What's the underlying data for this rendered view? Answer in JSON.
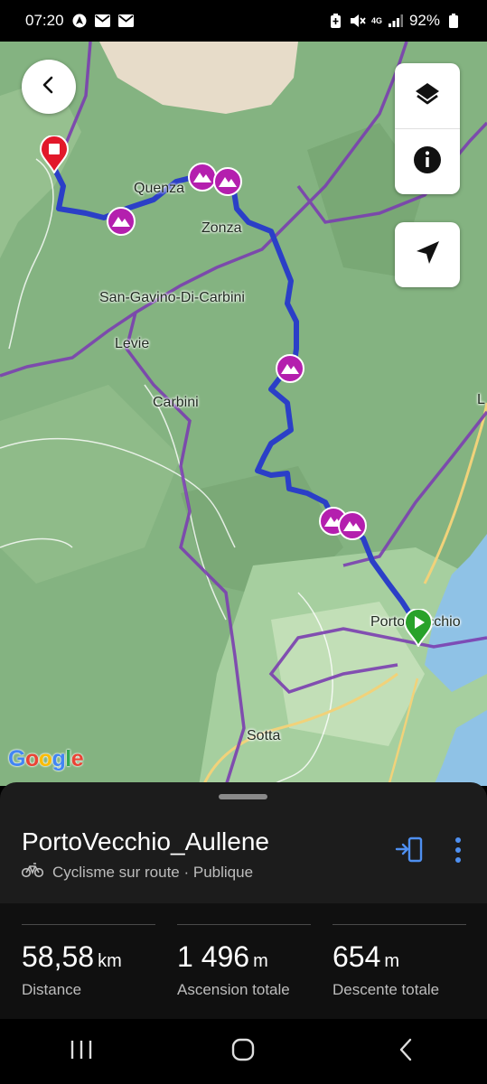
{
  "status_bar": {
    "time": "07:20",
    "network": "4G",
    "battery": "92%"
  },
  "map": {
    "places": [
      "Quenza",
      "Zonza",
      "San-Gavino-Di-Carbini",
      "Levie",
      "Carbini",
      "Porto-Vecchio",
      "Sotta",
      "L"
    ],
    "google_label": "Google",
    "icons": {
      "back": "back-arrow-icon",
      "layers": "layers-icon",
      "info": "info-icon",
      "locate": "navigation-arrow-icon",
      "start": "start-flag-icon",
      "end": "end-flag-icon",
      "climb": "climb-mountain-icon"
    },
    "colors": {
      "route": "#2b3fc7",
      "climb_marker": "#b41fae",
      "start_marker": "#29a22a",
      "end_marker": "#e2182a",
      "boundary": "#7b3fb0"
    }
  },
  "route": {
    "title": "PortoVecchio_Aullene",
    "activity": "Cyclisme sur route · Publique"
  },
  "stats": [
    {
      "value": "58,58",
      "unit": "km",
      "label": "Distance"
    },
    {
      "value": "1 496",
      "unit": "m",
      "label": "Ascension totale"
    },
    {
      "value": "654",
      "unit": "m",
      "label": "Descente totale"
    }
  ],
  "actions": {
    "send_icon": "send-to-device-icon",
    "more_icon": "more-vertical-icon",
    "accent_color": "#4e8ff0"
  }
}
